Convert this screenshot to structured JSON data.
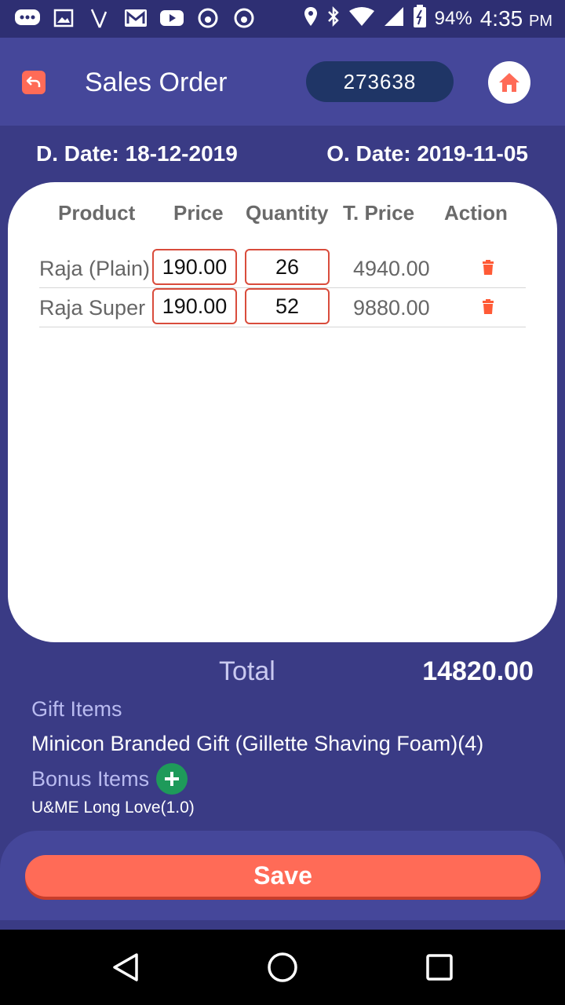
{
  "status_bar": {
    "battery": "94%",
    "time": "4:35",
    "ampm": "PM"
  },
  "header": {
    "title": "Sales Order",
    "order_number": "273638"
  },
  "dates": {
    "delivery": "D. Date: 18-12-2019",
    "order": "O. Date: 2019-11-05"
  },
  "table": {
    "headers": [
      "Product",
      "Price",
      "Quantity",
      "T. Price",
      "Action"
    ],
    "rows": [
      {
        "product": "Raja (Plain)",
        "price": "190.00",
        "quantity": "26",
        "total": "4940.00"
      },
      {
        "product": "Raja Super",
        "price": "190.00",
        "quantity": "52",
        "total": "9880.00"
      }
    ]
  },
  "summary": {
    "total_label": "Total",
    "total_value": "14820.00",
    "gift_label": "Gift Items",
    "gift_value": "Minicon Branded Gift (Gillette Shaving Foam)(4)",
    "bonus_label": "Bonus Items",
    "bonus_value": "U&ME Long Love(1.0)"
  },
  "footer": {
    "save_label": "Save"
  },
  "colors": {
    "background": "#3a3b85",
    "header": "#45479a",
    "accent": "#ff6b57",
    "order_pill": "#1f3566",
    "bonus_add": "#1e9a5a"
  },
  "icons": {
    "back": "back-arrow-icon",
    "home": "home-icon",
    "delete": "trash-icon",
    "add": "plus-icon"
  }
}
